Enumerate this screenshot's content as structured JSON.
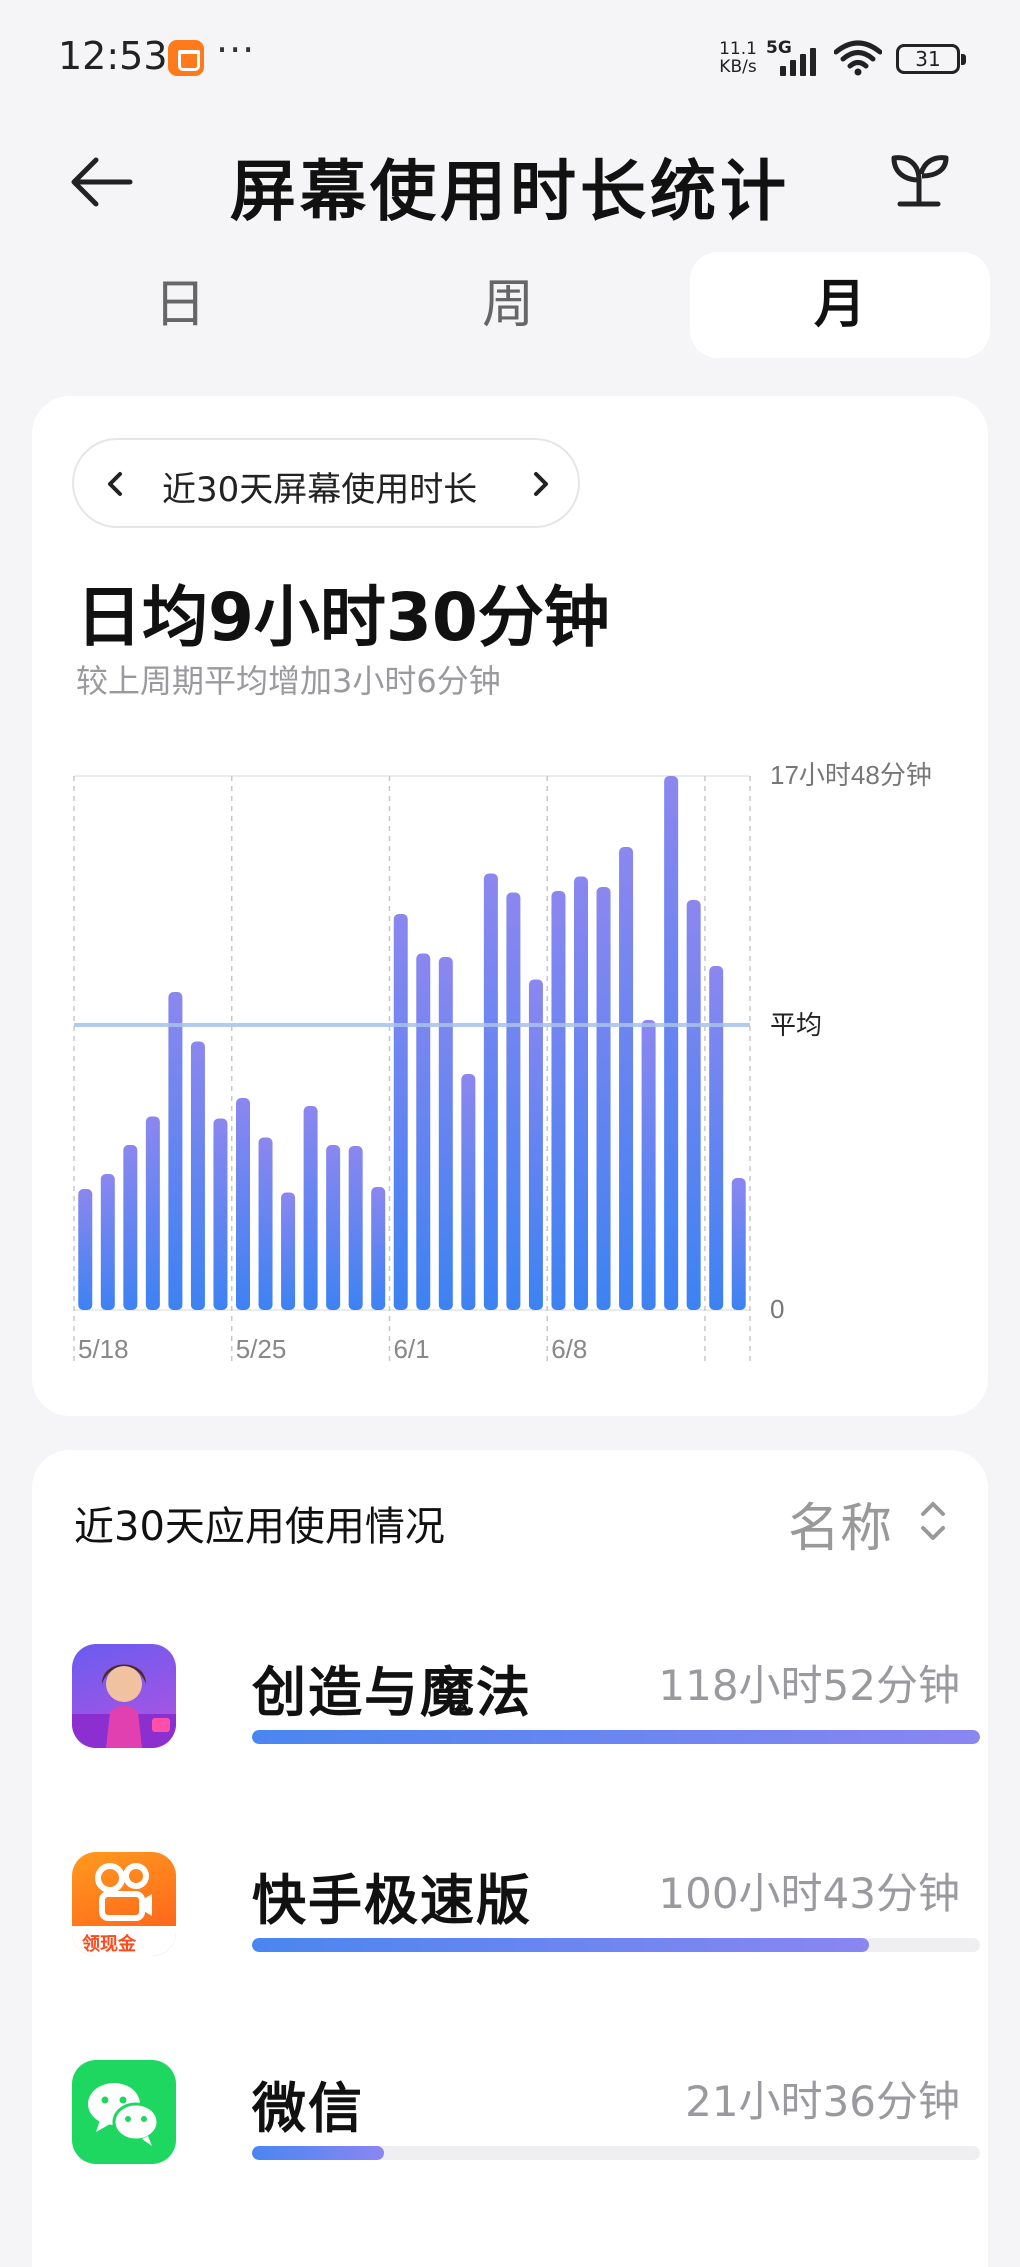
{
  "status_bar": {
    "time": "12:53",
    "extra": "···",
    "net_speed_value": "11.1",
    "net_speed_unit": "KB/s",
    "network_type": "5G",
    "battery": "31"
  },
  "header": {
    "title": "屏幕使用时长统计",
    "back_icon": "arrow-left-icon",
    "action_icon": "sprout-icon"
  },
  "tabs": [
    {
      "label": "日",
      "active": false
    },
    {
      "label": "周",
      "active": false
    },
    {
      "label": "月",
      "active": true
    }
  ],
  "summary": {
    "period_label": "近30天屏幕使用时长",
    "average": "日均9小时30分钟",
    "comparison": "较上周期平均增加3小时6分钟"
  },
  "chart_data": {
    "type": "bar",
    "unit": "minutes",
    "x_tick_labels": [
      "5/18",
      "5/25",
      "6/1",
      "6/8"
    ],
    "y_tick_labels": [
      "17小时48分钟",
      "0"
    ],
    "average_label": "平均",
    "average_value": 570,
    "ylim": [
      0,
      1068
    ],
    "values": [
      242,
      272,
      330,
      387,
      636,
      537,
      383,
      424,
      345,
      235,
      408,
      330,
      328,
      246,
      792,
      713,
      706,
      472,
      873,
      835,
      661,
      838,
      867,
      846,
      926,
      580,
      1068,
      820,
      688,
      264
    ],
    "colors": {
      "top": "#8b87ef",
      "bottom": "#3d82f2",
      "average_line": "#a9c2ea"
    }
  },
  "apps_section": {
    "title": "近30天应用使用情况",
    "sort_label": "名称",
    "apps": [
      {
        "name": "创造与魔法",
        "time": "118小时52分钟",
        "share": 1.0,
        "icon": "game-character-icon"
      },
      {
        "name": "快手极速版",
        "time": "100小时43分钟",
        "share": 0.847,
        "icon": "kuaishou-icon",
        "badge": "领现金"
      },
      {
        "name": "微信",
        "time": "21小时36分钟",
        "share": 0.182,
        "icon": "wechat-icon"
      }
    ]
  }
}
